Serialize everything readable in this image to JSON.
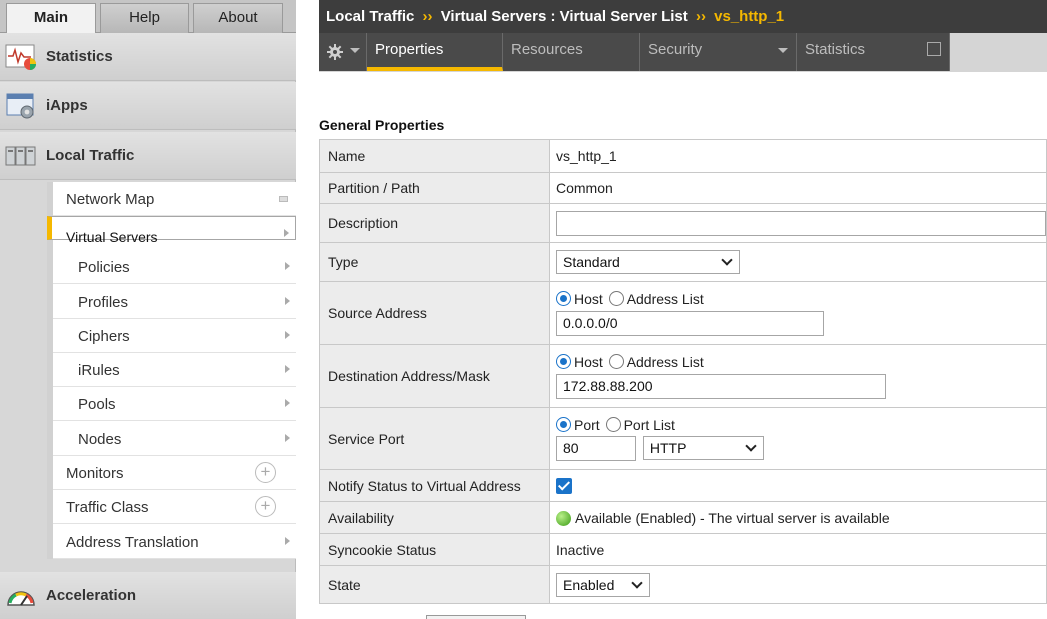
{
  "top_tabs": [
    {
      "label": "Main",
      "active": true
    },
    {
      "label": "Help",
      "active": false
    },
    {
      "label": "About",
      "active": false
    }
  ],
  "sections": {
    "statistics": "Statistics",
    "iapps": "iApps",
    "local_traffic": "Local Traffic",
    "acceleration": "Acceleration"
  },
  "submenu": {
    "network_map": "Network Map",
    "virtual_servers": "Virtual Servers",
    "policies": "Policies",
    "profiles": "Profiles",
    "ciphers": "Ciphers",
    "irules": "iRules",
    "pools": "Pools",
    "nodes": "Nodes",
    "monitors": "Monitors",
    "traffic_class": "Traffic Class",
    "address_translation": "Address Translation"
  },
  "breadcrumb": {
    "part1": "Local Traffic",
    "sep": "››",
    "part2": "Virtual Servers : Virtual Server List",
    "current": "vs_http_1"
  },
  "page_tabs": {
    "properties": "Properties",
    "resources": "Resources",
    "security": "Security",
    "statistics": "Statistics"
  },
  "general": {
    "title": "General Properties",
    "name_label": "Name",
    "name_value": "vs_http_1",
    "partition_label": "Partition / Path",
    "partition_value": "Common",
    "description_label": "Description",
    "description_value": "",
    "type_label": "Type",
    "type_value": "Standard",
    "source_label": "Source Address",
    "source_opt_host": "Host",
    "source_opt_list": "Address List",
    "source_value": "0.0.0.0/0",
    "dest_label": "Destination Address/Mask",
    "dest_opt_host": "Host",
    "dest_opt_list": "Address List",
    "dest_value": "172.88.88.200",
    "port_label": "Service Port",
    "port_opt_port": "Port",
    "port_opt_list": "Port List",
    "port_value": "80",
    "port_protocol": "HTTP",
    "notify_label": "Notify Status to Virtual Address",
    "notify_checked": true,
    "availability_label": "Availability",
    "availability_value": "Available (Enabled) - The virtual server is available",
    "syncookie_label": "Syncookie Status",
    "syncookie_value": "Inactive",
    "state_label": "State",
    "state_value": "Enabled"
  }
}
